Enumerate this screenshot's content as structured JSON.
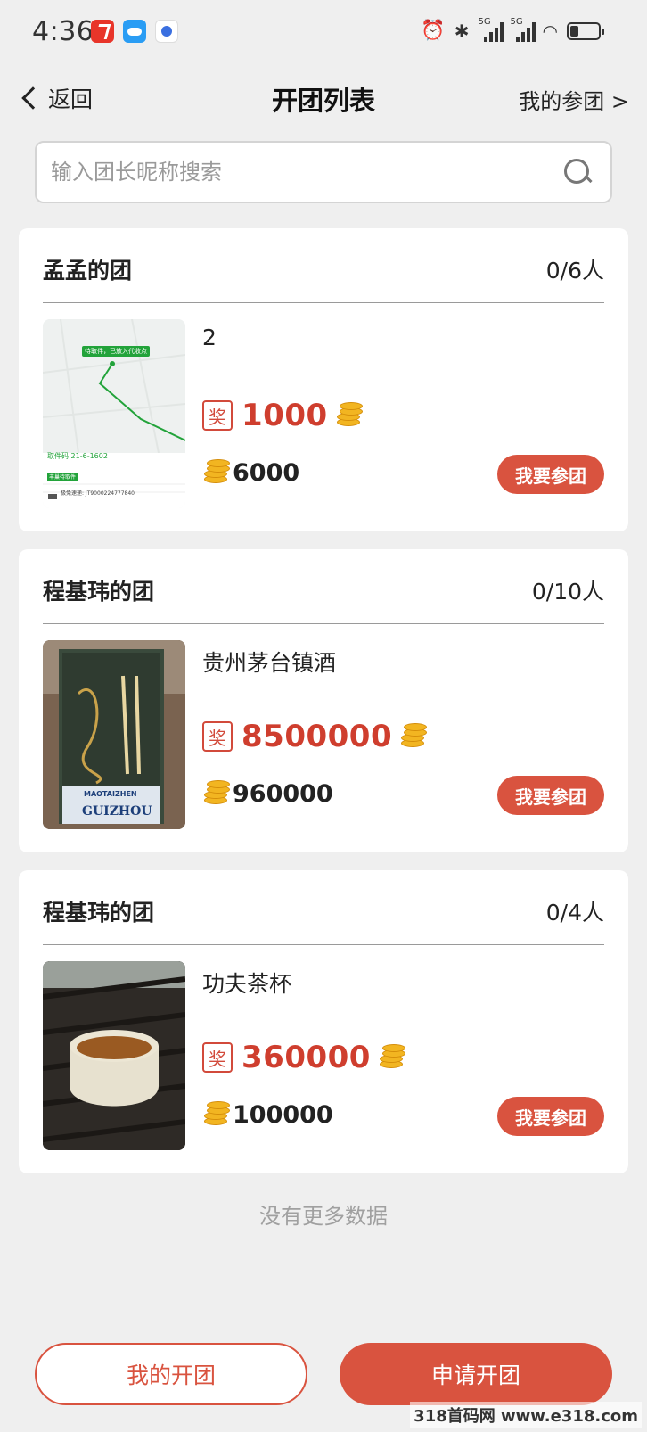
{
  "status_bar": {
    "time": "4:36"
  },
  "nav": {
    "back_label": "返回",
    "title": "开团列表",
    "my_join_label": "我的参团 >"
  },
  "search": {
    "placeholder": "输入团长昵称搜索"
  },
  "groups": [
    {
      "leader": "孟孟的团",
      "count": "0/6人",
      "product": "2",
      "prize_tag": "奖",
      "prize": "1000",
      "coins": "6000",
      "join_label": "我要参团",
      "thumb": {
        "top_badge": "待取件，已放入代收点",
        "code": "取件码 21-6-1602",
        "status_badge": "丰巢待取件",
        "tracking": "极兔速递: JT9000224777840"
      }
    },
    {
      "leader": "程基玮的团",
      "count": "0/10人",
      "product": "贵州茅台镇酒",
      "prize_tag": "奖",
      "prize": "8500000",
      "coins": "960000",
      "join_label": "我要参团",
      "thumb": {
        "label_line1": "MAOTAIZHEN",
        "label_line2": "GUIZHOU"
      }
    },
    {
      "leader": "程基玮的团",
      "count": "0/4人",
      "product": "功夫茶杯",
      "prize_tag": "奖",
      "prize": "360000",
      "coins": "100000",
      "join_label": "我要参团"
    }
  ],
  "footer": {
    "no_more": "没有更多数据",
    "my_groups_label": "我的开团",
    "apply_label": "申请开团"
  },
  "watermark": "318首码网 www.e318.com",
  "colors": {
    "accent": "#d9533f",
    "prize": "#cf3e2e",
    "coin": "#f2b521",
    "background": "#efefef"
  }
}
